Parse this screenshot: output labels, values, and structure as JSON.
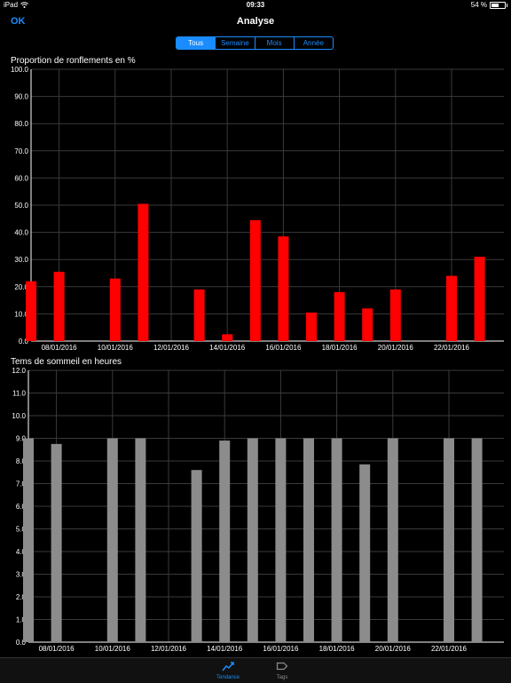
{
  "status_bar": {
    "device": "iPad",
    "time": "09:33",
    "battery": "54 %",
    "battery_level": 0.54
  },
  "nav": {
    "ok_label": "OK",
    "title": "Analyse"
  },
  "segments": [
    {
      "label": "Tous",
      "active": true
    },
    {
      "label": "Semaine",
      "active": false
    },
    {
      "label": "Mois",
      "active": false
    },
    {
      "label": "Année",
      "active": false
    }
  ],
  "colors": {
    "accent": "#1a8cff",
    "snoring_bar": "#ff0000",
    "sleep_bar": "#8c8c8c",
    "grid": "#3a3a3a"
  },
  "chart_data": [
    {
      "type": "bar",
      "title": "Proportion de ronflements en %",
      "ylim": [
        0,
        100
      ],
      "yticks": [
        0,
        10,
        20,
        30,
        40,
        50,
        60,
        70,
        80,
        90,
        100
      ],
      "ytick_labels": [
        "0.0",
        "10.0",
        "20.0",
        "30.0",
        "40.0",
        "50.0",
        "60.0",
        "70.0",
        "80.0",
        "90.0",
        "100.0"
      ],
      "xlim": [
        "2016-01-07",
        "2016-01-22"
      ],
      "xtick_labels": [
        "08/01/2016",
        "10/01/2016",
        "12/01/2016",
        "14/01/2016",
        "16/01/2016",
        "18/01/2016",
        "20/01/2016",
        "22/01/2016"
      ],
      "grid": true,
      "bars": [
        {
          "date": "2016-01-07",
          "value": 22
        },
        {
          "date": "2016-01-08",
          "value": 25.5
        },
        {
          "date": "2016-01-10",
          "value": 23
        },
        {
          "date": "2016-01-11",
          "value": 50.5
        },
        {
          "date": "2016-01-13",
          "value": 19
        },
        {
          "date": "2016-01-14",
          "value": 2.5
        },
        {
          "date": "2016-01-15",
          "value": 44.5
        },
        {
          "date": "2016-01-16",
          "value": 38.5
        },
        {
          "date": "2016-01-17",
          "value": 10.5
        },
        {
          "date": "2016-01-18",
          "value": 18
        },
        {
          "date": "2016-01-19",
          "value": 12
        },
        {
          "date": "2016-01-20",
          "value": 19
        },
        {
          "date": "2016-01-22",
          "value": 24
        },
        {
          "date": "2016-01-23",
          "value": 31
        }
      ]
    },
    {
      "type": "bar",
      "title": "Tems de sommeil en heures",
      "ylim": [
        0,
        12
      ],
      "yticks": [
        0,
        1,
        2,
        3,
        4,
        5,
        6,
        7,
        8,
        9,
        10,
        11,
        12
      ],
      "ytick_labels": [
        "0.0",
        "1.0",
        "2.0",
        "3.0",
        "4.0",
        "5.0",
        "6.0",
        "7.0",
        "8.0",
        "9.0",
        "10.0",
        "11.0",
        "12.0"
      ],
      "xlim": [
        "2016-01-07",
        "2016-01-22"
      ],
      "xtick_labels": [
        "08/01/2016",
        "10/01/2016",
        "12/01/2016",
        "14/01/2016",
        "16/01/2016",
        "18/01/2016",
        "20/01/2016",
        "22/01/2016"
      ],
      "grid": true,
      "bars": [
        {
          "date": "2016-01-07",
          "value": 9
        },
        {
          "date": "2016-01-08",
          "value": 8.75
        },
        {
          "date": "2016-01-10",
          "value": 9
        },
        {
          "date": "2016-01-11",
          "value": 9
        },
        {
          "date": "2016-01-13",
          "value": 7.6
        },
        {
          "date": "2016-01-14",
          "value": 8.9
        },
        {
          "date": "2016-01-15",
          "value": 9
        },
        {
          "date": "2016-01-16",
          "value": 9
        },
        {
          "date": "2016-01-17",
          "value": 9
        },
        {
          "date": "2016-01-18",
          "value": 9
        },
        {
          "date": "2016-01-19",
          "value": 7.85
        },
        {
          "date": "2016-01-20",
          "value": 9
        },
        {
          "date": "2016-01-22",
          "value": 9
        },
        {
          "date": "2016-01-23",
          "value": 9
        }
      ]
    }
  ],
  "tabs": [
    {
      "label": "Tendance",
      "icon": "trend-icon",
      "active": true
    },
    {
      "label": "Tags",
      "icon": "tag-icon",
      "active": false
    }
  ]
}
